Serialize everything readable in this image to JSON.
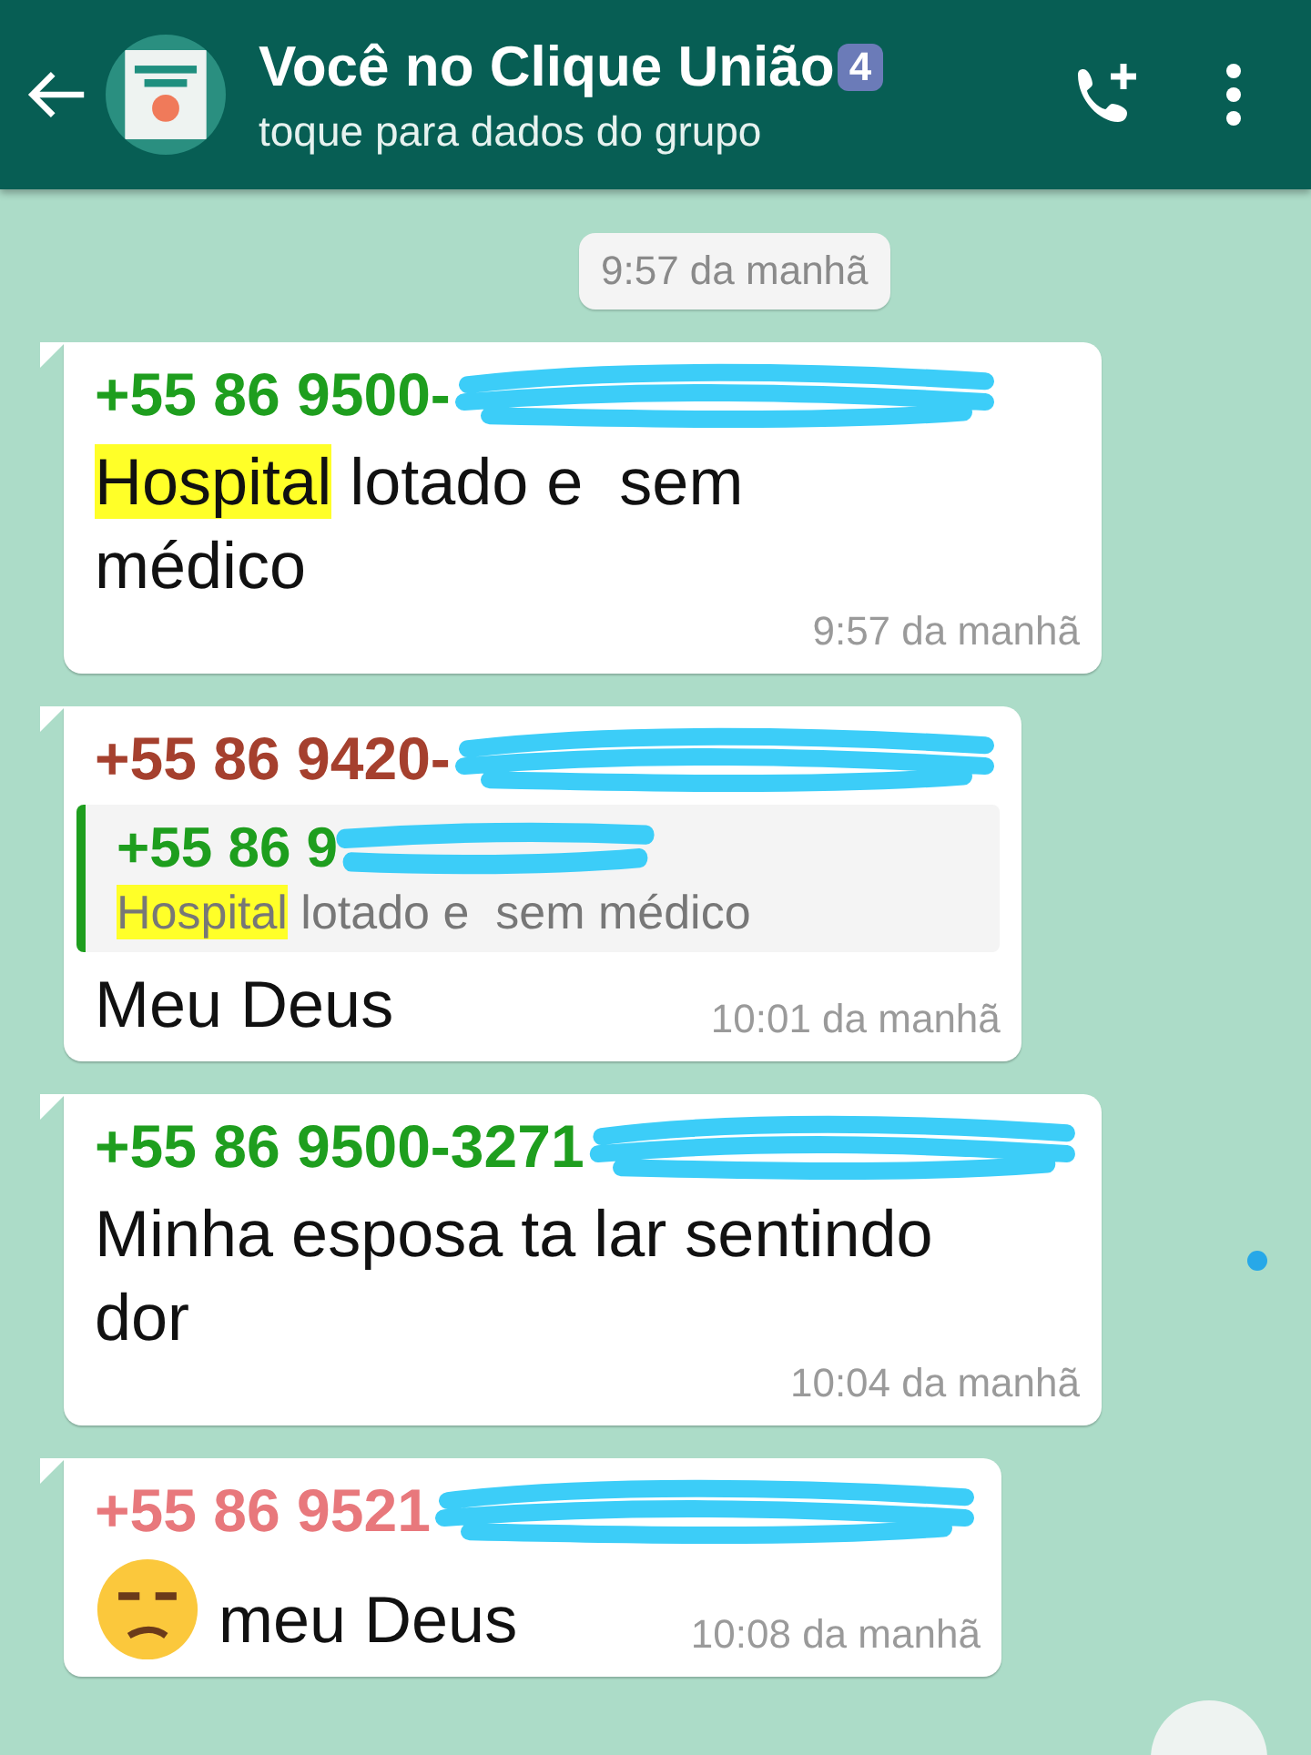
{
  "header": {
    "title": "Você no Clique União",
    "title_badge": "4",
    "subtitle": "toque para dados do grupo"
  },
  "time_chip": "9:57 da manhã",
  "messages": [
    {
      "sender": "+55 86 9500-",
      "color": "#1e9e1e",
      "parts": [
        {
          "text": "Hospital",
          "highlighted": true
        },
        {
          "text": " lotado e  sem médico",
          "highlighted": false
        }
      ],
      "time": "9:57 da manhã"
    },
    {
      "sender": "+55 86 9420-",
      "color": "#a5402e",
      "quote": {
        "sender": "+55 86 9",
        "color": "#1e9e1e",
        "parts": [
          {
            "text": "Hospital",
            "highlighted": true
          },
          {
            "text": " lotado e  sem médico",
            "highlighted": false
          }
        ]
      },
      "parts": [
        {
          "text": "Meu Deus",
          "highlighted": false
        }
      ],
      "time": "10:01 da manhã"
    },
    {
      "sender": "+55 86 9500-3271",
      "color": "#1e9e1e",
      "parts": [
        {
          "text": "Minha esposa ta lar sentindo dor",
          "highlighted": false
        }
      ],
      "time": "10:04 da manhã",
      "unread_dot": true
    },
    {
      "sender": "+55 86 9521",
      "color": "#e8787c",
      "emoji": true,
      "parts": [
        {
          "text": "meu Deus",
          "highlighted": false
        }
      ],
      "time": "10:08 da manhã"
    }
  ]
}
